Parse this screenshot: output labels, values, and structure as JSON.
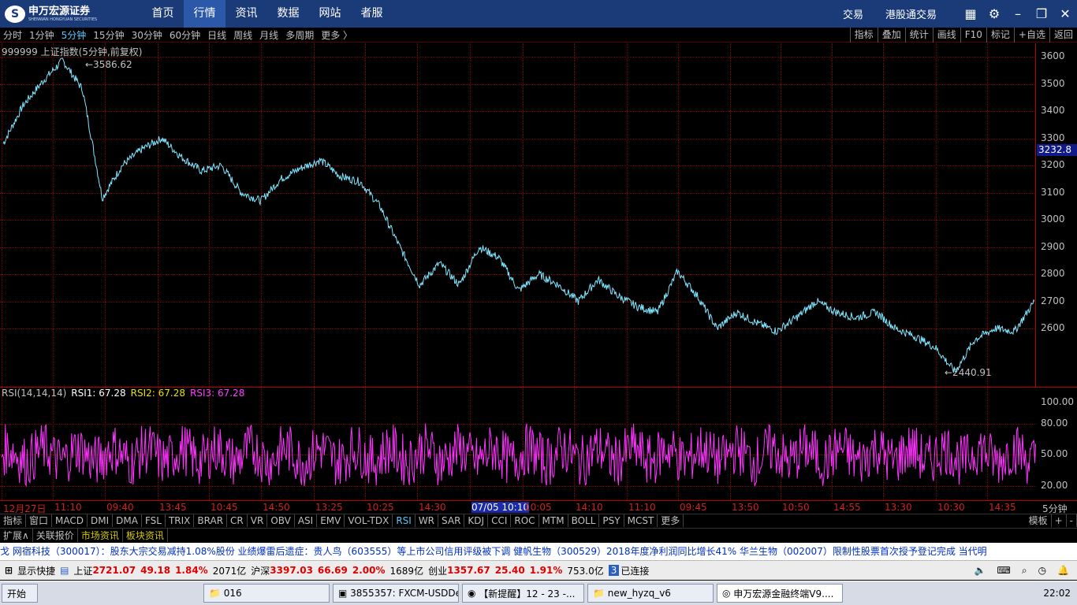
{
  "topbar": {
    "logo_text": "申万宏源证券",
    "logo_sub": "SHENWAN HONGYUAN SECURITIES",
    "nav": [
      "首页",
      "行情",
      "资讯",
      "数据",
      "网站",
      "者服"
    ],
    "active_nav": "行情",
    "right_links": [
      "交易",
      "港股通交易"
    ]
  },
  "periods": [
    "分时",
    "1分钟",
    "5分钟",
    "15分钟",
    "30分钟",
    "60分钟",
    "日线",
    "周线",
    "月线",
    "多周期",
    "更多 〉"
  ],
  "active_period": "5分钟",
  "period_right": [
    "指标",
    "叠加",
    "统计",
    "画线",
    "F10",
    "标记",
    "+自选",
    "返回"
  ],
  "chart": {
    "title": "999999 上证指数(5分钟,前复权)",
    "high_label": "3586.62",
    "low_label": "2440.91",
    "last_price": "3232.8",
    "y_ticks": [
      "3600",
      "3500",
      "3400",
      "3300",
      "3200",
      "3100",
      "3000",
      "2900",
      "2800",
      "2700",
      "2600"
    ],
    "rsi_title": "RSI(14,14,14)",
    "rsi1": "RSI1: 67.28",
    "rsi2": "RSI2: 67.28",
    "rsi3": "RSI3: 67.28",
    "rsi_ticks": [
      "100.00",
      "80.00",
      "50.00",
      "20.00"
    ],
    "time_labels": [
      "12月27日",
      "11:10",
      "09:40",
      "13:45",
      "10:45",
      "14:50",
      "13:25",
      "10:25",
      "14:30",
      "07/05 10:10",
      "10:05",
      "14:10",
      "11:10",
      "09:45",
      "13:50",
      "10:50",
      "14:55",
      "13:30",
      "10:30",
      "14:35"
    ],
    "period_label": "5分钟"
  },
  "chart_data": {
    "type": "line",
    "title": "999999 上证指数(5分钟,前复权)",
    "ylim": [
      2440,
      3620
    ],
    "series": [
      {
        "name": "上证指数",
        "values": [
          3280,
          3420,
          3510,
          3586.62,
          3480,
          3080,
          3200,
          3260,
          3300,
          3230,
          3180,
          3200,
          3100,
          3070,
          3150,
          3190,
          3220,
          3160,
          3140,
          3050,
          2900,
          2760,
          2840,
          2760,
          2900,
          2860,
          2740,
          2800,
          2760,
          2700,
          2780,
          2720,
          2680,
          2660,
          2810,
          2720,
          2600,
          2660,
          2620,
          2590,
          2640,
          2700,
          2660,
          2640,
          2660,
          2600,
          2570,
          2530,
          2440.91,
          2560,
          2600,
          2590,
          2700
        ]
      }
    ],
    "rsi": {
      "name": "RSI",
      "ylim": [
        0,
        100
      ],
      "last": 67.28
    }
  },
  "indicators": [
    "指标",
    "窗口",
    "MACD",
    "DMI",
    "DMA",
    "FSL",
    "TRIX",
    "BRAR",
    "CR",
    "VR",
    "OBV",
    "ASI",
    "EMV",
    "VOL-TDX",
    "RSI",
    "WR",
    "SAR",
    "KDJ",
    "CCI",
    "ROC",
    "MTM",
    "BOLL",
    "PSY",
    "MCST",
    "更多"
  ],
  "active_indicator": "RSI",
  "ind_right": [
    "模板",
    "+",
    "-"
  ],
  "news_tabs": [
    "扩展∧",
    "关联报价",
    "市场资讯",
    "板块资讯"
  ],
  "ticker": "戈      网宿科技（300017）：股东大宗交易减持1.08%股份        业绩爆雷后遗症：贵人鸟（603555）等上市公司信用评级被下调        健帆生物（300529）2018年度净利润同比增长41%        华兰生物（002007）限制性股票首次授予登记完成        当代明",
  "status": {
    "quick": "显示快捷",
    "sh_label": "上证",
    "sh_price": "2721.07",
    "sh_change": "49.18",
    "sh_pct": "1.84%",
    "sh_amount": "2071亿",
    "hs_label": "沪深",
    "hs_price": "3397.03",
    "hs_change": "66.69",
    "hs_pct": "2.00%",
    "hs_amount": "1689亿",
    "cy_label": "创业",
    "cy_price": "1357.67",
    "cy_change": "25.40",
    "cy_pct": "1.91%",
    "cy_amount": "753.0亿",
    "conn_num": "3",
    "conn": "已连接"
  },
  "taskbar": {
    "start": "开始",
    "tasks": [
      "016",
      "3855357: FXCM-USDDe...",
      "【新提醒】12 - 23 -...",
      "new_hyzq_v6",
      "申万宏源金融终端V9...."
    ],
    "clock": "22:02"
  }
}
